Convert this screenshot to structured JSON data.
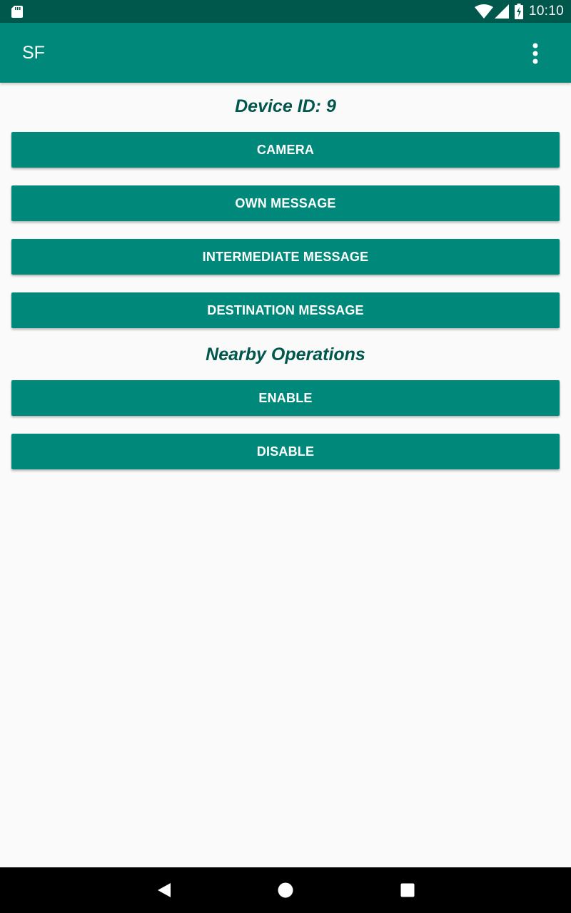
{
  "status_bar": {
    "time": "10:10",
    "icons": [
      "sd-card-icon",
      "wifi-icon",
      "cell-signal-icon",
      "battery-charging-icon"
    ]
  },
  "app_bar": {
    "title": "SF",
    "menu_icon": "more-vert-icon"
  },
  "main": {
    "device_heading": "Device ID: 9",
    "message_buttons": [
      "CAMERA",
      "OWN MESSAGE",
      "INTERMEDIATE MESSAGE",
      "DESTINATION MESSAGE"
    ],
    "nearby_heading": "Nearby Operations",
    "nearby_buttons": [
      "ENABLE",
      "DISABLE"
    ]
  },
  "nav_bar": {
    "icons": [
      "back-icon",
      "home-icon",
      "recents-icon"
    ]
  },
  "colors": {
    "status_bar": "#00574b",
    "app_bar": "#00897b",
    "button": "#00897b",
    "heading_text": "#00574b",
    "background": "#fafafa"
  }
}
